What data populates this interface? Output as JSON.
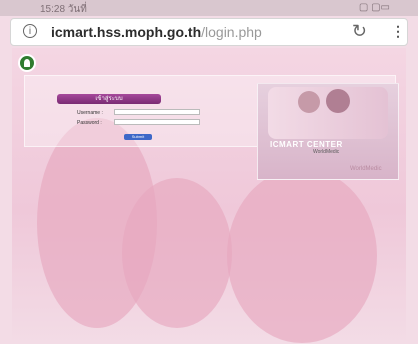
{
  "status": {
    "time": "15:28 วันที่",
    "right": "▢ ▢▭"
  },
  "browser": {
    "info_icon": "info-circle-icon",
    "host": "icmart.hss.moph.go.th",
    "path": "/login.php",
    "reload_icon": "reload-icon",
    "menu_icon": "more-vert-icon"
  },
  "login": {
    "button": "เข้าสู่ระบบ",
    "username_label": "Username :",
    "password_label": "Password :",
    "submit": "Submit",
    "link": ""
  },
  "promo": {
    "title": "ICMART CENTER",
    "subtitle": "",
    "brand": "WorldMedic"
  },
  "footer": {
    "copyright": "",
    "brand": "WorldMedic"
  }
}
